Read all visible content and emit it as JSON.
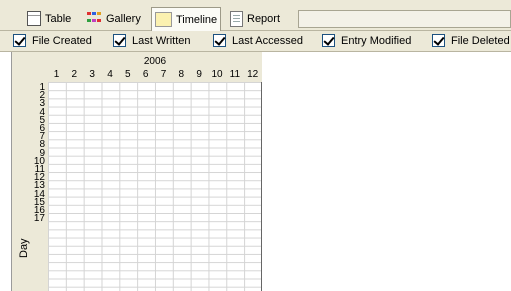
{
  "tabs": [
    {
      "label": "Table",
      "icon": "table-icon"
    },
    {
      "label": "Gallery",
      "icon": "gallery-icon"
    },
    {
      "label": "Timeline",
      "icon": "timeline-icon",
      "selected": true
    },
    {
      "label": "Report",
      "icon": "report-icon"
    }
  ],
  "filters": [
    {
      "label": "File Created",
      "checked": true
    },
    {
      "label": "Last Written",
      "checked": true
    },
    {
      "label": "Last Accessed",
      "checked": true
    },
    {
      "label": "Entry Modified",
      "checked": true
    },
    {
      "label": "File Deleted",
      "checked": true
    }
  ],
  "timeline": {
    "year": "2006",
    "months": [
      "1",
      "2",
      "3",
      "4",
      "5",
      "6",
      "7",
      "8",
      "9",
      "10",
      "11",
      "12"
    ],
    "days": [
      "1",
      "2",
      "3",
      "4",
      "5",
      "6",
      "7",
      "8",
      "9",
      "10",
      "11",
      "12",
      "13",
      "14",
      "15",
      "16",
      "17"
    ],
    "day_axis_label": "Day"
  },
  "colors": {
    "gallery": [
      "#e03030",
      "#3060e0",
      "#e0a020",
      "#30a040",
      "#c040c0",
      "#e03030"
    ]
  }
}
